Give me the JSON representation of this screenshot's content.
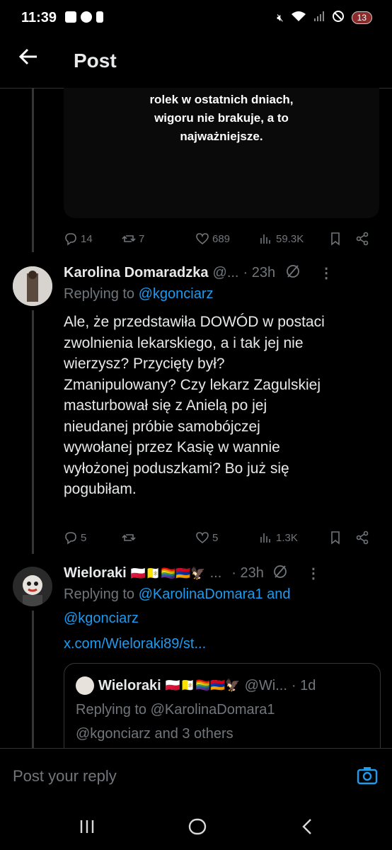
{
  "status": {
    "time": "11:39",
    "notif_count": "13"
  },
  "header": {
    "title": "Post"
  },
  "prev_post": {
    "media_text": "rolek w ostatnich dniach,\nwigoru nie brakuje, a to\nnajważniejsze.",
    "replies": "14",
    "reposts": "7",
    "likes": "689",
    "views": "59.3K"
  },
  "post1": {
    "name": "Karolina Domaradzka",
    "handle": "@...",
    "time": "· 23h",
    "replying_label": "Replying to",
    "replying_user": "@kgonciarz",
    "text": "Ale, że przedstawiła DOWÓD w postaci\nzwolnienia lekarskiego, a i tak jej nie\nwierzysz? Przycięty był?\nZmanipulowany? Czy lekarz Zagulskiej\nmasturbował się z Anielą po jej\nnieudanej próbie samobójczej\nwywołanej przez Kasię w wannie\nwyłożonej poduszkami? Bo już się\npogubiłam.",
    "replies": "5",
    "reposts": "",
    "likes": "5",
    "views": "1.3K"
  },
  "post2": {
    "name": "Wieloraki",
    "flags": "🇵🇱🇻🇦🏳️‍🌈🇦🇲🦅",
    "handle": "...",
    "time": "· 23h",
    "replying_label": "Replying to",
    "replying_users": "@KarolinaDomara1 and",
    "replying_users2": "@kgonciarz",
    "link": "x.com/Wieloraki89/st..."
  },
  "quote": {
    "name": "Wieloraki",
    "flags": "🇵🇱🇻🇦🏳️‍🌈🇦🇲🦅",
    "handle": "@Wi...",
    "time": "· 1d",
    "replying_line1": "Replying to @KarolinaDomara1",
    "replying_line2": "@kgonciarz and 3 others"
  },
  "composer": {
    "placeholder": "Post your reply"
  },
  "colors": {
    "accent": "#1d9bf0",
    "muted": "#71767b",
    "background": "#000000"
  }
}
